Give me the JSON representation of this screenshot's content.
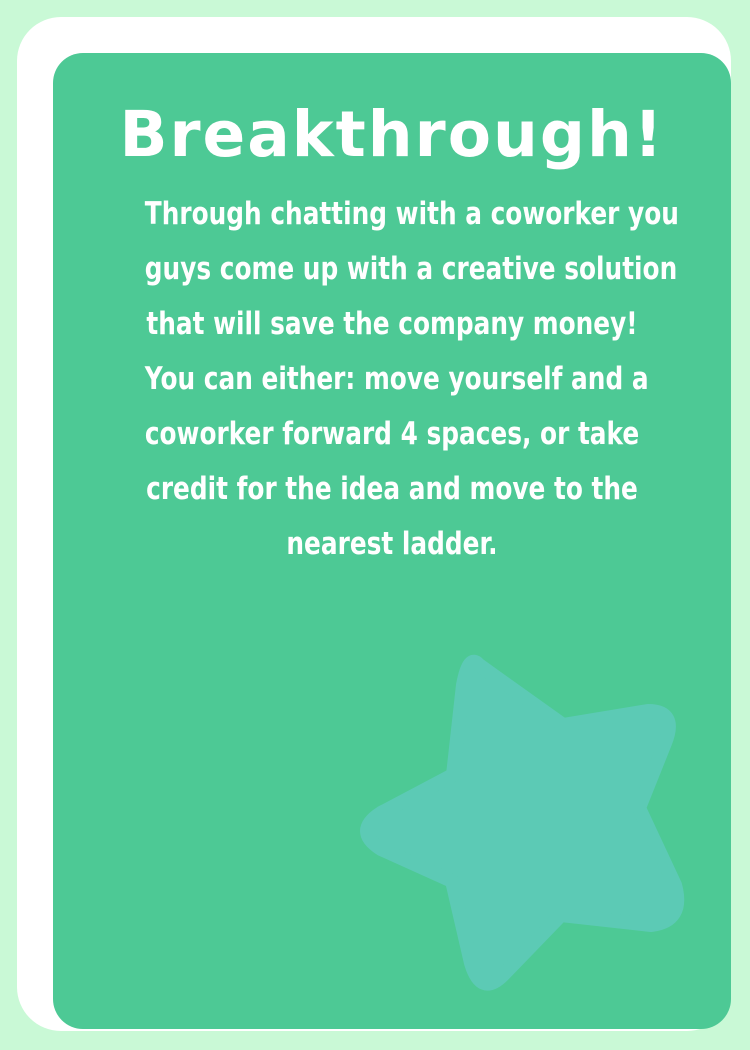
{
  "card": {
    "title": "Breakthrough!",
    "body_lines": [
      "Through chatting with a coworker you",
      "guys come up with a creative solution",
      "that will save the company money!",
      "You can either: move yourself and a",
      "coworker forward 4 spaces, or take",
      "credit for the idea and move to the",
      "nearest ladder."
    ],
    "icon": "star-icon",
    "colors": {
      "background": "#c9f9d6",
      "border": "#ffffff",
      "face": "#4dc995",
      "star": "#5ccab5",
      "text": "#ffffff"
    }
  }
}
